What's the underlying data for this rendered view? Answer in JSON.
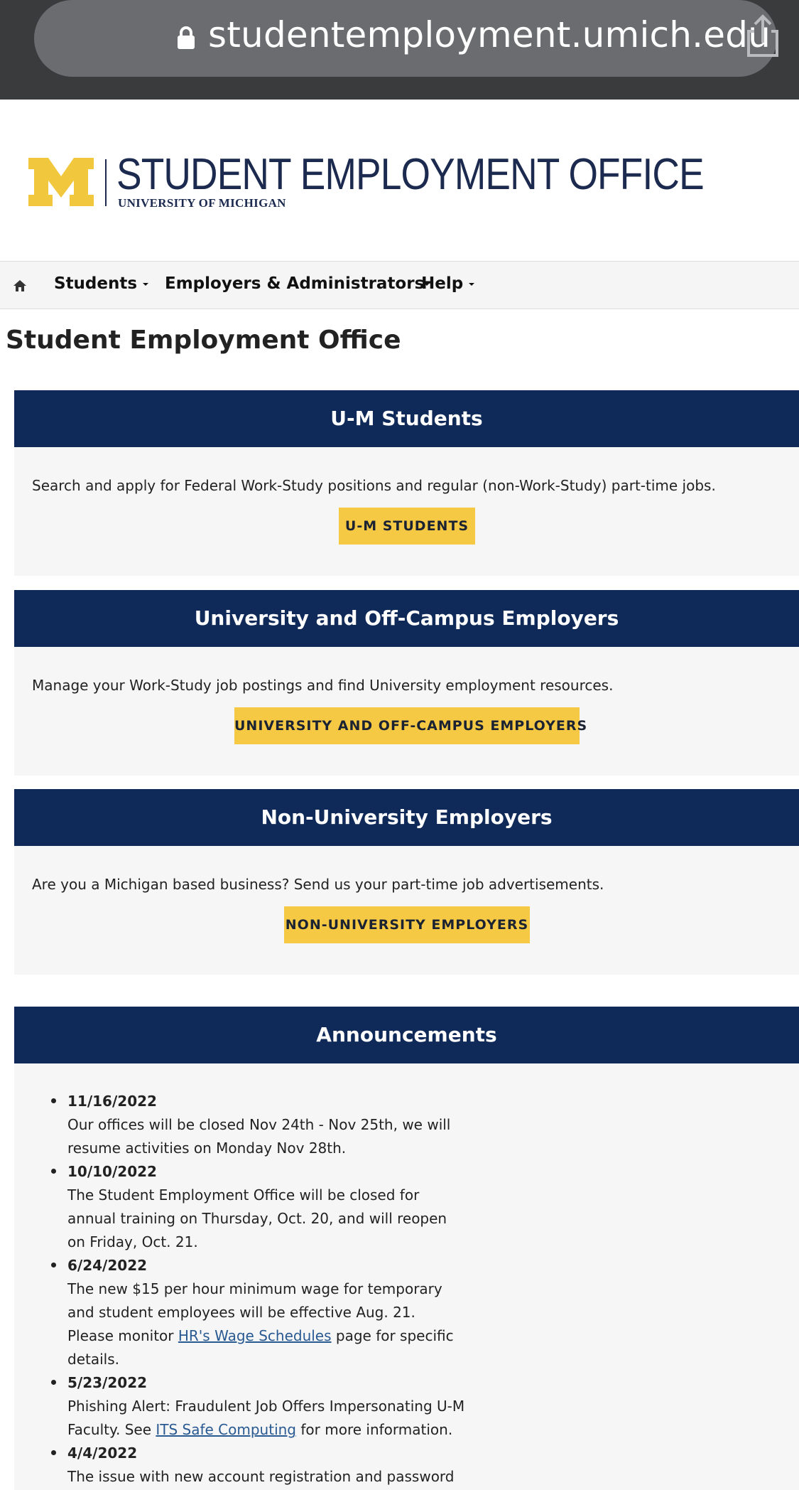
{
  "browser": {
    "url": "studentemployment.umich.edu",
    "icons": {
      "lock": "lock-icon",
      "share": "share-icon"
    }
  },
  "header": {
    "logo_title": "STUDENT EMPLOYMENT OFFICE",
    "logo_subtitle": "UNIVERSITY OF MICHIGAN",
    "colors": {
      "maize": "#f1c73e",
      "blue": "#1b2a4e"
    }
  },
  "nav": {
    "home_icon": "home-icon",
    "items": [
      {
        "label": "Students"
      },
      {
        "label": "Employers & Administrators"
      },
      {
        "label": "Help"
      }
    ]
  },
  "page": {
    "title": "Student Employment Office"
  },
  "panels": [
    {
      "heading": "U-M Students",
      "description": "Search and apply for Federal Work-Study positions and regular (non-Work-Study) part-time jobs.",
      "button": "U-M STUDENTS"
    },
    {
      "heading": "University and Off-Campus Employers",
      "description": "Manage your Work-Study job postings and find University employment resources.",
      "button": "UNIVERSITY AND OFF-CAMPUS EMPLOYERS"
    },
    {
      "heading": "Non-University Employers",
      "description": "Are you a Michigan based business? Send us your part-time job advertisements.",
      "button": "NON-UNIVERSITY EMPLOYERS"
    }
  ],
  "announcements": {
    "heading": "Announcements",
    "items": [
      {
        "date": "11/16/2022",
        "text": "Our offices will be closed Nov 24th - Nov 25th, we will resume activities on Monday Nov 28th."
      },
      {
        "date": "10/10/2022",
        "text": "The Student Employment Office will be closed for annual training on Thursday, Oct. 20, and will reopen on Friday, Oct. 21."
      },
      {
        "date": "6/24/2022",
        "text_before": "The new $15 per hour minimum wage for temporary and student employees will be effective Aug. 21. Please monitor ",
        "link": "HR's Wage Schedules",
        "text_after": " page for specific details."
      },
      {
        "date": "5/23/2022",
        "text_before": "Phishing Alert: Fraudulent Job Offers Impersonating U-M Faculty. See ",
        "link": "ITS Safe Computing",
        "text_after": " for more information."
      },
      {
        "date": "4/4/2022",
        "text": "The issue with new account registration and password"
      }
    ]
  },
  "colors": {
    "panel_header": "#0f2a59",
    "button_bg": "#f6c944",
    "panel_bg": "#f6f6f6",
    "link": "#2a5a92"
  }
}
